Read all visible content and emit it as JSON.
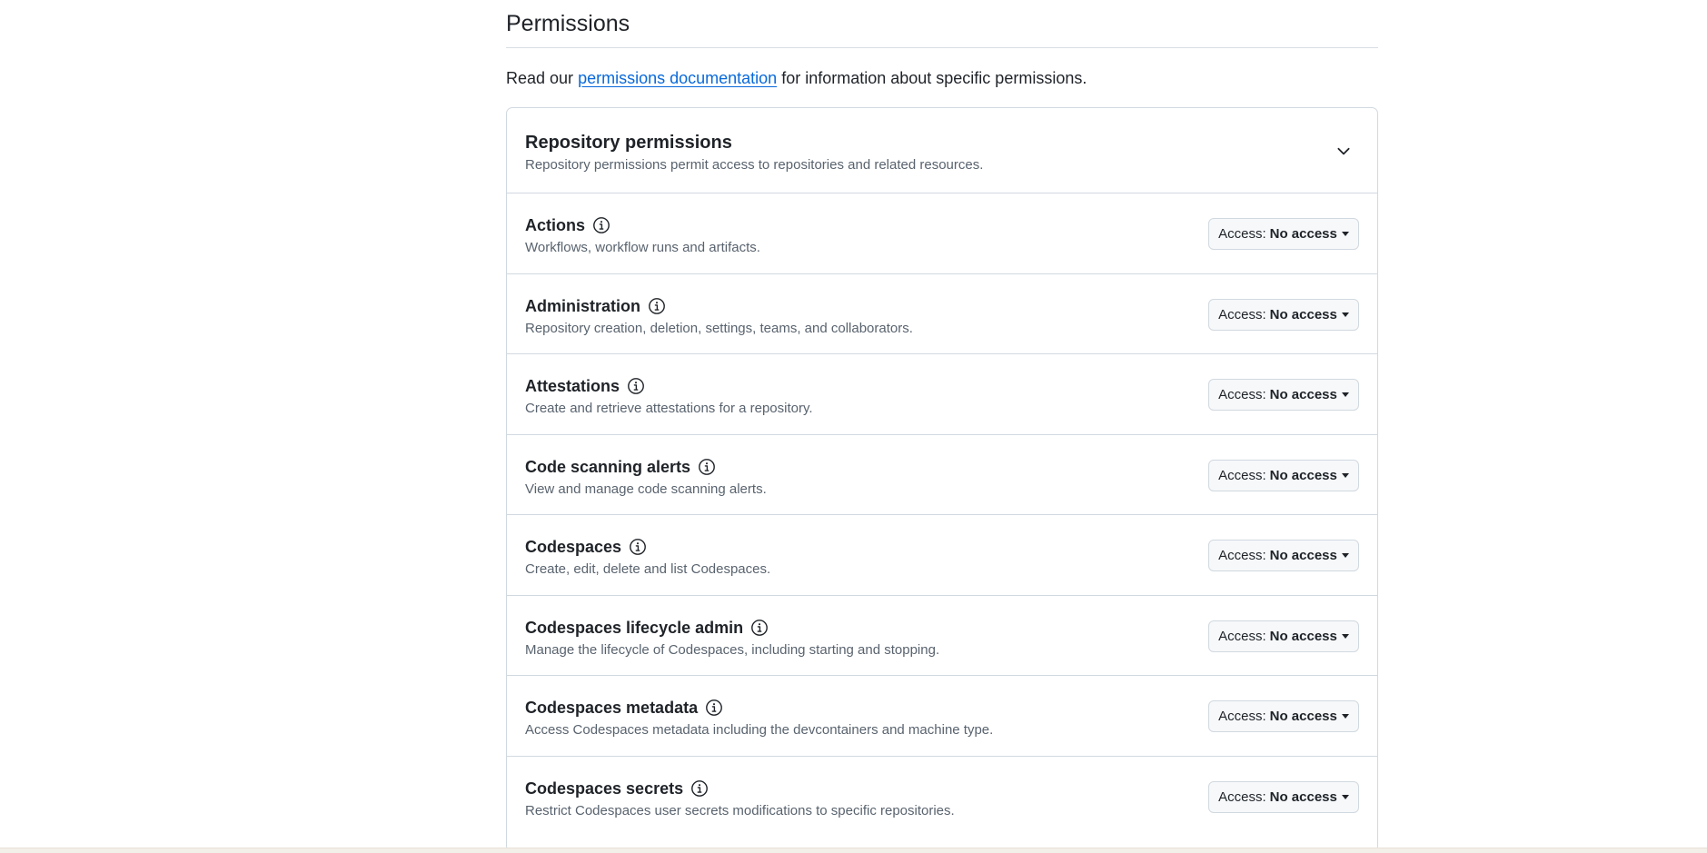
{
  "section": {
    "title": "Permissions",
    "intro_prefix": "Read our ",
    "intro_link": "permissions documentation",
    "intro_suffix": " for information about specific permissions."
  },
  "repository_permissions": {
    "title": "Repository permissions",
    "description": "Repository permissions permit access to repositories and related resources.",
    "access_label": "Access:",
    "items": [
      {
        "title": "Actions",
        "description": "Workflows, workflow runs and artifacts.",
        "access": "No access"
      },
      {
        "title": "Administration",
        "description": "Repository creation, deletion, settings, teams, and collaborators.",
        "access": "No access"
      },
      {
        "title": "Attestations",
        "description": "Create and retrieve attestations for a repository.",
        "access": "No access"
      },
      {
        "title": "Code scanning alerts",
        "description": "View and manage code scanning alerts.",
        "access": "No access"
      },
      {
        "title": "Codespaces",
        "description": "Create, edit, delete and list Codespaces.",
        "access": "No access"
      },
      {
        "title": "Codespaces lifecycle admin",
        "description": "Manage the lifecycle of Codespaces, including starting and stopping.",
        "access": "No access"
      },
      {
        "title": "Codespaces metadata",
        "description": "Access Codespaces metadata including the devcontainers and machine type.",
        "access": "No access"
      },
      {
        "title": "Codespaces secrets",
        "description": "Restrict Codespaces user secrets modifications to specific repositories.",
        "access": "No access"
      }
    ]
  },
  "icons": {
    "info": "info-icon",
    "chevron": "chevron-down-icon",
    "caret": "caret-down-icon"
  },
  "colors": {
    "link": "#0969da",
    "text": "#1f2328",
    "muted": "#59636e",
    "border": "#d1d9e0",
    "button_bg": "#f6f8fa"
  }
}
